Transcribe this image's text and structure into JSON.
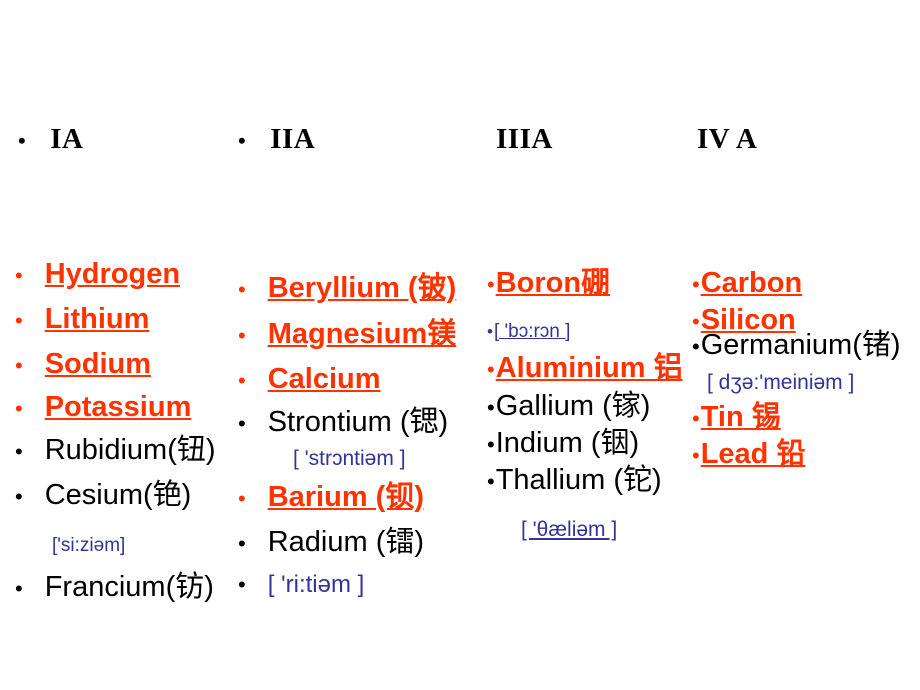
{
  "slide": {
    "background_color": "#FFFFFF",
    "accent_color": "#FF3300",
    "phonetic_color": "#333399",
    "text_color": "#000000"
  },
  "headers": [
    {
      "label": "IA",
      "bullet": "•",
      "has_bullet": true
    },
    {
      "label": "IIA",
      "bullet": "•",
      "has_bullet": true
    },
    {
      "label": "IIIA",
      "bullet": "",
      "has_bullet": false
    },
    {
      "label": "IV A",
      "bullet": "",
      "has_bullet": false
    }
  ],
  "columns": {
    "group_IA": {
      "items": [
        {
          "name": "Hydrogen",
          "chinese": "",
          "highlight": true
        },
        {
          "name": "Lithium",
          "chinese": "",
          "highlight": true
        },
        {
          "name": "Sodium",
          "chinese": "",
          "highlight": true
        },
        {
          "name": "Potassium",
          "chinese": "",
          "highlight": true
        },
        {
          "name": "Rubidium",
          "chinese": "(钮)",
          "highlight": false
        },
        {
          "name": "Cesium",
          "chinese": "(铯)",
          "highlight": false
        },
        {
          "name": "Francium",
          "chinese": "(钫)",
          "highlight": false
        }
      ],
      "phonetics": [
        {
          "text": "['si:ziəm]",
          "for": "Cesium"
        }
      ]
    },
    "group_IIA": {
      "items": [
        {
          "name": "Beryllium",
          "chinese": " (铍)",
          "highlight": true
        },
        {
          "name": "Magnesium",
          "chinese": "镁",
          "highlight": true
        },
        {
          "name": "Calcium",
          "chinese": "",
          "highlight": true
        },
        {
          "name": "Strontium",
          "chinese": " (锶)",
          "highlight": false
        },
        {
          "name": "Barium",
          "chinese": " (钡)",
          "highlight": true
        },
        {
          "name": "Radium",
          "chinese": " (镭)",
          "highlight": false
        }
      ],
      "phonetics": [
        {
          "text": "[ 'strɔntiəm ]",
          "for": "Strontium"
        },
        {
          "text": "[ 'ri:tiəm ]",
          "for": "Radium"
        }
      ]
    },
    "group_IIIA": {
      "items": [
        {
          "name": "Boron",
          "chinese": "硼",
          "highlight": true
        },
        {
          "name": "Aluminium",
          "chinese": " 铝",
          "highlight": true
        },
        {
          "name": "Gallium",
          "chinese": " (镓)",
          "highlight": false
        },
        {
          "name": "Indium",
          "chinese": " (铟)",
          "highlight": false
        },
        {
          "name": "Thallium",
          "chinese": " (铊)",
          "highlight": false
        }
      ],
      "phonetics": [
        {
          "text": "[ 'bɔ:rɔn ]",
          "for": "Boron"
        },
        {
          "text": "[ 'θæliəm ]",
          "for": "Thallium"
        }
      ]
    },
    "group_IVA": {
      "items": [
        {
          "name": "Carbon",
          "chinese": "",
          "highlight": true
        },
        {
          "name": "Silicon",
          "chinese": "",
          "highlight": true
        },
        {
          "name": "Germanium",
          "chinese": "(锗)",
          "highlight": false
        },
        {
          "name": "Tin",
          "chinese": " 锡",
          "highlight": true
        },
        {
          "name": "Lead",
          "chinese": " 铅",
          "highlight": true
        }
      ],
      "phonetics": [
        {
          "text": "[ dʒə:'meiniəm ]",
          "for": "Germanium"
        }
      ]
    }
  },
  "bullets": {
    "dot": "•"
  }
}
